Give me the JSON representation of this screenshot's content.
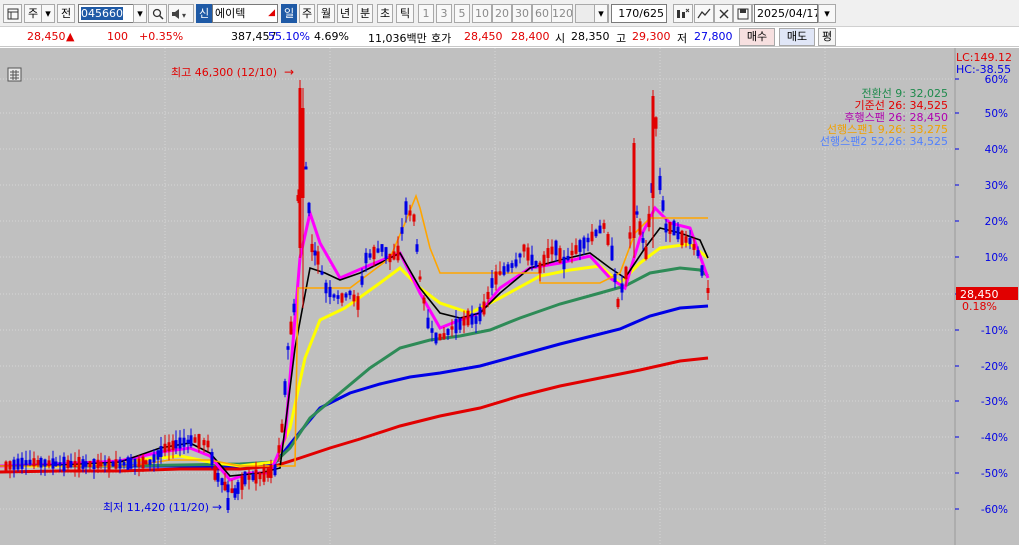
{
  "toolbar": {
    "period_selector": "주",
    "market_selector": "전",
    "stock_code": "045660",
    "credit_badge": "신",
    "stock_name": "에이텍",
    "period_buttons": [
      "일",
      "주",
      "월",
      "년",
      "분",
      "초",
      "틱"
    ],
    "interval_buttons": [
      "1",
      "3",
      "5",
      "10",
      "20",
      "30",
      "60",
      "120"
    ],
    "bar_count": "170/625",
    "date": "2025/04/17"
  },
  "info": {
    "price": "28,450",
    "change_arrow": "▲",
    "change": "100",
    "change_pct": "+0.35%",
    "volume": "387,457",
    "volume_ratio": "55.10%",
    "turnover": "4.69%",
    "trade_value": "11,036백만",
    "quote_label": "호가",
    "ask": "28,450",
    "bid": "28,400",
    "open_label": "시",
    "open": "28,350",
    "high_label": "고",
    "high": "29,300",
    "low_label": "저",
    "low": "27,800",
    "buy_button": "매수",
    "sell_button": "매도",
    "eval_button": "평"
  },
  "chart_data": {
    "type": "candlestick",
    "title": "",
    "lc_label": "LC:149.12",
    "hc_label": "HC:-38.55",
    "y_axis_ticks": [
      "60%",
      "50%",
      "40%",
      "30%",
      "20%",
      "10%",
      "0%",
      "-10%",
      "-20%",
      "-30%",
      "-40%",
      "-50%",
      "-60%"
    ],
    "y_range_pct": [
      -60,
      60
    ],
    "current_price_label": "28,450",
    "current_pct_label": "0.18%",
    "high_annotation": "최고 46,300 (12/10)",
    "low_annotation": "최저 11,420 (11/20)",
    "legend": [
      {
        "name": "전환선 9: 32,025",
        "color": "#1e8a4c"
      },
      {
        "name": "기준선 26: 34,525",
        "color": "#e10000"
      },
      {
        "name": "후행스팬 26: 28,450",
        "color": "#b000b0"
      },
      {
        "name": "선행스팬1 9,26: 33,275",
        "color": "#f0a000"
      },
      {
        "name": "선행스팬2 52,26: 34,525",
        "color": "#5080ff"
      }
    ],
    "colors": {
      "up_candle": "#e10000",
      "down_candle": "#0000e6",
      "background": "#c0c0c0"
    }
  }
}
